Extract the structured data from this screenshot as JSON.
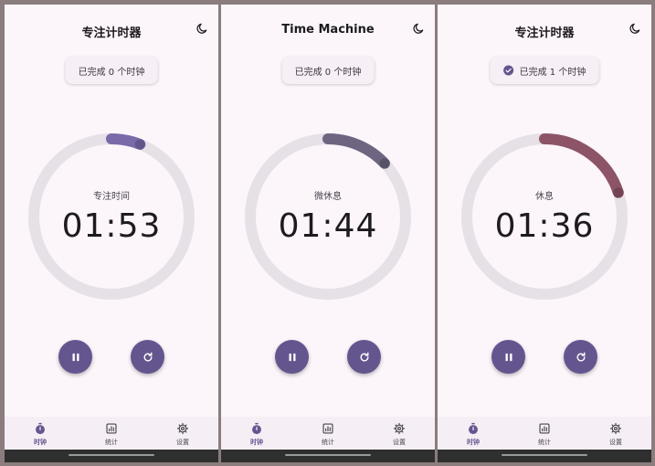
{
  "colors": {
    "accent": "#65558f",
    "ring_track": "#e6e0e7",
    "focus_arc": "#7a6aaa",
    "short_break_arc": "#6e6680",
    "long_break_arc": "#8d5468",
    "background": "#fcf6fb",
    "navbar": "#f5eff5"
  },
  "phones": [
    {
      "header": {
        "title": "专注计时器",
        "theme_icon": "moon-icon"
      },
      "badge": {
        "text": "已完成 0 个时钟",
        "show_check": false
      },
      "timer": {
        "phase": "专注时间",
        "time": "01:53",
        "progress": 0.06
      },
      "controls": {
        "pause_icon": "pause-icon",
        "reset_icon": "refresh-icon"
      },
      "nav": [
        {
          "label": "时钟",
          "icon": "stopwatch-icon",
          "active": true
        },
        {
          "label": "统计",
          "icon": "bar-chart-icon",
          "active": false
        },
        {
          "label": "设置",
          "icon": "gear-icon",
          "active": false
        }
      ]
    },
    {
      "header": {
        "title": "Time Machine",
        "theme_icon": "moon-icon"
      },
      "badge": {
        "text": "已完成 0 个时钟",
        "show_check": false
      },
      "timer": {
        "phase": "微休息",
        "time": "01:44",
        "progress": 0.13
      },
      "controls": {
        "pause_icon": "pause-icon",
        "reset_icon": "refresh-icon"
      },
      "nav": [
        {
          "label": "时钟",
          "icon": "stopwatch-icon",
          "active": true
        },
        {
          "label": "统计",
          "icon": "bar-chart-icon",
          "active": false
        },
        {
          "label": "设置",
          "icon": "gear-icon",
          "active": false
        }
      ]
    },
    {
      "header": {
        "title": "专注计时器",
        "theme_icon": "moon-icon"
      },
      "badge": {
        "text": "已完成 1 个时钟",
        "show_check": true
      },
      "timer": {
        "phase": "休息",
        "time": "01:36",
        "progress": 0.2
      },
      "controls": {
        "pause_icon": "pause-icon",
        "reset_icon": "refresh-icon"
      },
      "nav": [
        {
          "label": "时钟",
          "icon": "stopwatch-icon",
          "active": true
        },
        {
          "label": "统计",
          "icon": "bar-chart-icon",
          "active": false
        },
        {
          "label": "设置",
          "icon": "gear-icon",
          "active": false
        }
      ]
    }
  ]
}
